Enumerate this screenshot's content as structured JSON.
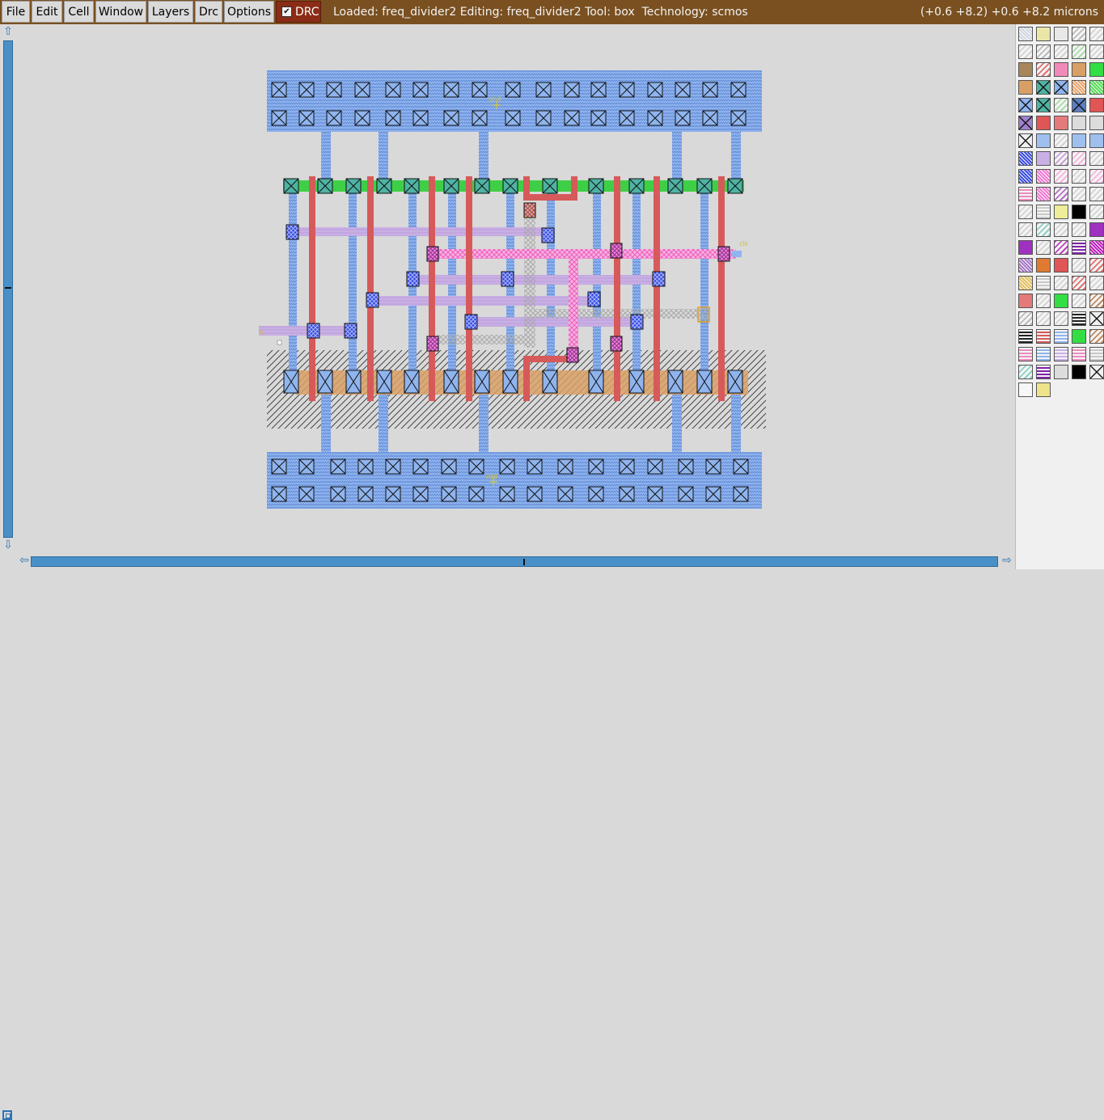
{
  "menu": [
    {
      "name": "menu-file",
      "label": "File"
    },
    {
      "name": "menu-edit",
      "label": "Edit"
    },
    {
      "name": "menu-cell",
      "label": "Cell"
    },
    {
      "name": "menu-window",
      "label": "Window"
    },
    {
      "name": "menu-layers",
      "label": "Layers"
    },
    {
      "name": "menu-drc",
      "label": "Drc"
    },
    {
      "name": "menu-options",
      "label": "Options"
    }
  ],
  "drc": {
    "label": "DRC",
    "checked": true
  },
  "status": {
    "text": "Loaded: freq_divider2 Editing: freq_divider2 Tool: box  Technology: scmos"
  },
  "coordinates": {
    "text": "(+0.6 +8.2) +0.6 +8.2 microns"
  },
  "labels": {
    "gnd": "gnd",
    "vdd": "vdd",
    "clk": "clk",
    "q": "q"
  },
  "colors": {
    "titlebar": "#7a5020",
    "metal1": "#8fb4ee",
    "poly": "#d65a5a",
    "metal2": "#c6a8e0",
    "via_blue": "#3d4fe0",
    "pink_metal": "#f27cc7",
    "pdiff": "#d9a066",
    "ndiff_green": "#3fcf46",
    "contact": "#4fb3a3"
  },
  "palette": [
    [
      "checker",
      "gold-outline",
      "gray-box",
      "black-hatch",
      "gray-hatch"
    ],
    [
      "gray-hatch",
      "black-hatch",
      "gray-hatch",
      "green-hatch",
      "gray-hatch"
    ],
    [
      "brown",
      "red-hatch",
      "pink",
      "tan",
      "green"
    ],
    [
      "tan",
      "teal-contact",
      "blue-cross",
      "orange-dots",
      "green-dots"
    ],
    [
      "blue-cross",
      "teal-contact",
      "green-hatch",
      "navy-contact",
      "red"
    ],
    [
      "purple-cross",
      "red",
      "red-light",
      "gray-light",
      "gray-light"
    ],
    [
      "black-cross",
      "blue-wave",
      "gray-hatch",
      "blue-wave",
      "blue-wave"
    ],
    [
      "blue-check",
      "lavender",
      "violet-hatch",
      "pink-hatch",
      "gray-hatch"
    ],
    [
      "blue-check",
      "pink-check",
      "pink-hatch",
      "gray-hatch",
      "pink-hatch"
    ],
    [
      "pink-stripe",
      "pink-check",
      "purple-hatch",
      "gray-hatch",
      "gray-hatch"
    ],
    [
      "gray-hatch",
      "gray-stripe",
      "yellow-light",
      "black",
      "gray-hatch"
    ],
    [
      "gray-hatch",
      "teal-hatch",
      "gray-hatch",
      "gray-hatch",
      "purple"
    ],
    [
      "purple",
      "gray-hatch",
      "magenta-hatch",
      "purple-stripe",
      "magenta-check"
    ],
    [
      "violet-dots",
      "orange",
      "red",
      "gray-hatch",
      "red-hatch"
    ],
    [
      "gold-check",
      "gray-stripe",
      "gray-hatch",
      "red-hatch",
      "gray-hatch"
    ],
    [
      "red-light",
      "gray-hatch",
      "green",
      "gray-hatch",
      "brown-hatch"
    ],
    [
      "black-hatch",
      "gray-hatch",
      "gray-hatch",
      "black-stripe",
      "black-cross"
    ],
    [
      "black-stripe",
      "red-stripe",
      "blue-stripe",
      "green",
      "brown-hatch"
    ],
    [
      "pink-stripe",
      "blue-stripe",
      "lavender-stripe",
      "pink-stripe",
      "gray-stripe"
    ],
    [
      "teal-hatch",
      "purple-stripe",
      "gray-light",
      "black",
      "black-cross"
    ],
    [
      "white-dots",
      "gold-light"
    ]
  ]
}
